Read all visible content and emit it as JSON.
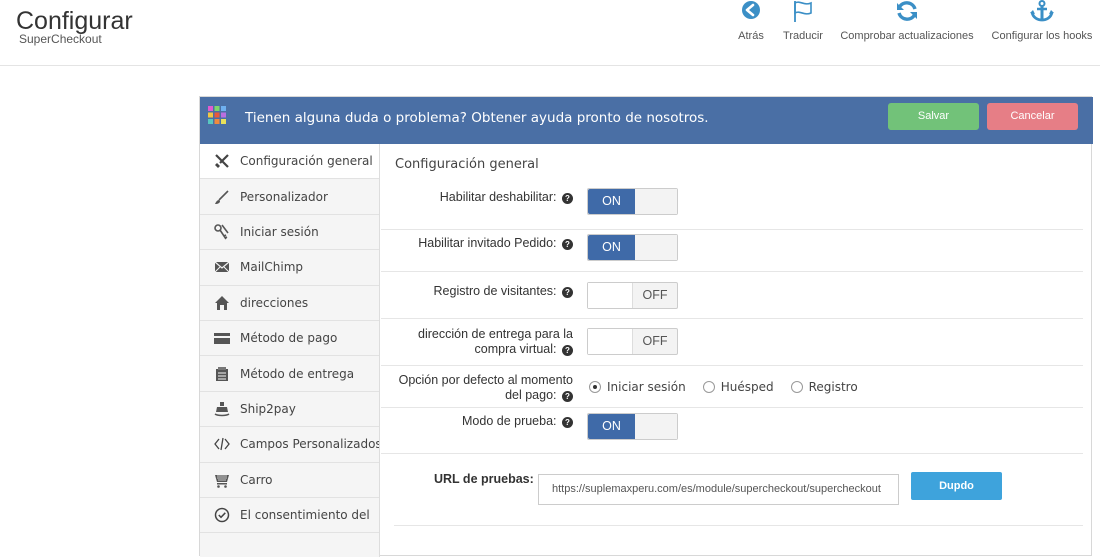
{
  "header": {
    "title": "Configurar",
    "subtitle": "SuperCheckout",
    "toolbar": [
      {
        "label": "Atrás",
        "icon": "back-circle-icon"
      },
      {
        "label": "Traducir",
        "icon": "flag-icon"
      },
      {
        "label": "Comprobar actualizaciones",
        "icon": "refresh-icon"
      },
      {
        "label": "Configurar los hooks",
        "icon": "anchor-icon"
      }
    ]
  },
  "panel": {
    "help_text": "Tienen alguna duda o problema? Obtener ayuda pronto de nosotros.",
    "save_label": "Salvar",
    "cancel_label": "Cancelar"
  },
  "sidebar": {
    "items": [
      {
        "label": "Configuración general",
        "icon": "tools-icon",
        "active": true
      },
      {
        "label": "Personalizador",
        "icon": "brush-icon"
      },
      {
        "label": "Iniciar sesión",
        "icon": "keys-icon"
      },
      {
        "label": "MailChimp",
        "icon": "envelope-icon"
      },
      {
        "label": "direcciones",
        "icon": "home-icon"
      },
      {
        "label": "Método de pago",
        "icon": "credit-card-icon"
      },
      {
        "label": "Método de entrega",
        "icon": "box-icon"
      },
      {
        "label": "Ship2pay",
        "icon": "ship-icon"
      },
      {
        "label": "Campos Personalizados",
        "icon": "code-icon"
      },
      {
        "label": "Carro",
        "icon": "cart-icon"
      },
      {
        "label": "El consentimiento del",
        "icon": "check-circle-icon"
      }
    ]
  },
  "settings": {
    "section_title": "Configuración general",
    "rows": [
      {
        "label": "Habilitar deshabilitar:",
        "state": "ON"
      },
      {
        "label": "Habilitar invitado Pedido:",
        "state": "ON"
      },
      {
        "label": "Registro de visitantes:",
        "state": "OFF"
      },
      {
        "label_line1": "dirección de entrega para la",
        "label_line2": "compra virtual:",
        "state": "OFF"
      },
      {
        "label_line1": "Opción por defecto al momento",
        "label_line2": "del pago:",
        "options": [
          "Iniciar sesión",
          "Huésped",
          "Registro"
        ],
        "selected": "Iniciar sesión"
      },
      {
        "label": "Modo de prueba:",
        "state": "ON"
      }
    ],
    "on_text": "ON",
    "off_text": "OFF",
    "help_glyph": "?"
  },
  "test_url": {
    "label": "URL de pruebas:",
    "value": "https://suplemaxperu.com/es/module/supercheckout/supercheckout",
    "copy_label": "Dupdo"
  },
  "colors": {
    "header_bar": "#4a6fa5",
    "save": "#72c279",
    "cancel": "#e67e86",
    "toggle_on": "#3f6aa8",
    "copy": "#3ea3dc",
    "toolbar_icon": "#3b8fc6"
  }
}
